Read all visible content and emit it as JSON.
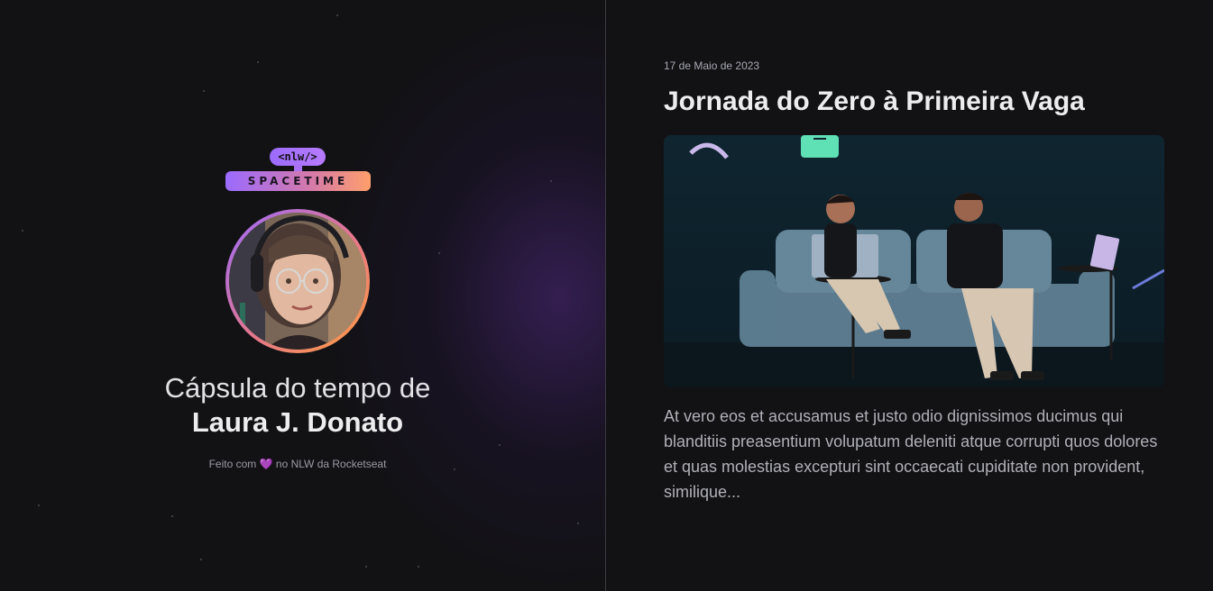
{
  "left": {
    "logo": {
      "top_text": "<nlw/>",
      "bottom_text": "SPACETIME"
    },
    "title_line1": "Cápsula do tempo de",
    "title_line2": "Laura J. Donato",
    "footer": {
      "before": "Feito com",
      "heart": "💜",
      "after": "no NLW da Rocketseat"
    }
  },
  "post": {
    "date": "17 de Maio de 2023",
    "title": "Jornada do Zero à Primeira Vaga",
    "body": "At vero eos et accusamus et justo odio dignissimos ducimus qui blanditiis preasentium volupatum deleniti atque corrupti quos dolores et quas molestias excepturi sint occaecati cupiditate non provident, similique..."
  },
  "colors": {
    "accent_purple": "#9b6bff",
    "accent_orange": "#ff9f6b",
    "background": "#121215"
  }
}
